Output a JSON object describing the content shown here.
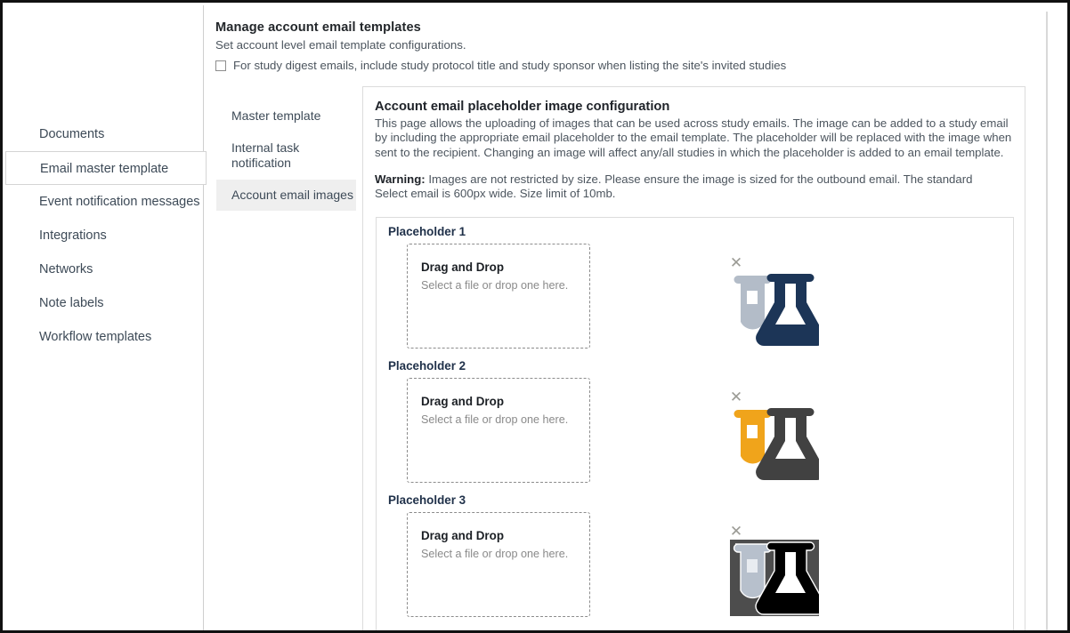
{
  "sidebar": {
    "items": [
      {
        "label": "Documents",
        "selected": false
      },
      {
        "label": "Email master template",
        "selected": true
      },
      {
        "label": "Event notification messages",
        "selected": false
      },
      {
        "label": "Integrations",
        "selected": false
      },
      {
        "label": "Networks",
        "selected": false
      },
      {
        "label": "Note labels",
        "selected": false
      },
      {
        "label": "Workflow templates",
        "selected": false
      }
    ]
  },
  "header": {
    "title": "Manage account email templates",
    "subtitle": "Set account level email template configurations.",
    "checkbox_label": "For study digest emails, include study protocol title and study sponsor when listing the site's invited studies",
    "checkbox_checked": false
  },
  "subnav": {
    "items": [
      {
        "label": "Master template",
        "active": false
      },
      {
        "label": "Internal task notification",
        "active": false
      },
      {
        "label": "Account email images",
        "active": true
      }
    ]
  },
  "main": {
    "title": "Account email placeholder image configuration",
    "paragraph": "This page allows the uploading of images that can be used across study emails. The image can be added to a study email by including the appropriate email placeholder to the email template. The placeholder will be replaced with the image when sent to the recipient. Changing an image will affect any/all studies in which the placeholder is added to an email template.",
    "warning_label": "Warning:",
    "warning_text": " Images are not restricted by size. Please ensure the image is sized for the outbound email. The standard Select email is 600px wide. Size limit of 10mb.",
    "placeholders": [
      {
        "label": "Placeholder 1",
        "dropzone_title": "Drag and Drop",
        "dropzone_subtitle": "Select a file or drop one here.",
        "remove_icon": "close-x",
        "image_name": "lab-flask-navy",
        "image_colors": {
          "tube": "#b3bcc8",
          "flask": "#1c3557",
          "background": "none"
        }
      },
      {
        "label": "Placeholder 2",
        "dropzone_title": "Drag and Drop",
        "dropzone_subtitle": "Select a file or drop one here.",
        "remove_icon": "close-x",
        "image_name": "lab-flask-orange",
        "image_colors": {
          "tube": "#f0a41b",
          "flask": "#414141",
          "background": "none"
        }
      },
      {
        "label": "Placeholder 3",
        "dropzone_title": "Drag and Drop",
        "dropzone_subtitle": "Select a file or drop one here.",
        "remove_icon": "close-x",
        "image_name": "lab-flask-black",
        "image_colors": {
          "tube": "#b7c0cc",
          "flask": "#000000",
          "background": "#4d4d4d"
        }
      }
    ]
  },
  "colors": {
    "accent_navy": "#1f3049",
    "text_body": "#4c555e",
    "border": "#dcdcdc",
    "highlight": "#efefef"
  }
}
